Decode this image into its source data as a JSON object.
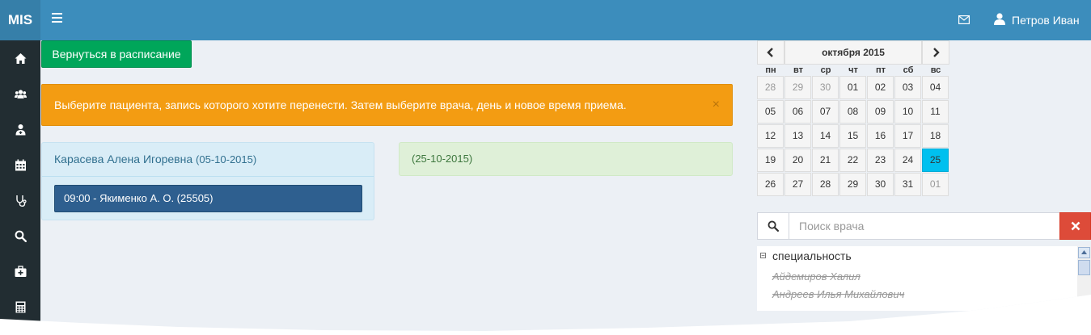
{
  "brand": "MIS",
  "header": {
    "user_name": "Петров Иван",
    "menu_icon": "hamburger-menu-icon",
    "mail_icon": "envelope-icon",
    "user_icon": "user-icon"
  },
  "sidebar": {
    "items": [
      {
        "icon": "home-icon"
      },
      {
        "icon": "users-icon"
      },
      {
        "icon": "doctor-icon"
      },
      {
        "icon": "calendar-icon"
      },
      {
        "icon": "stethoscope-icon"
      },
      {
        "icon": "search-icon"
      },
      {
        "icon": "medkit-icon"
      },
      {
        "icon": "calculator-icon"
      }
    ]
  },
  "actions": {
    "back_label": "Вернуться в расписание"
  },
  "alert": {
    "text": "Выберите пациента, запись которого хотите перенести. Затем выберите врача, день и новое время приема.",
    "close": "×"
  },
  "patient_panel": {
    "name": "Карасева Алена Игоревна",
    "date": "(05-10-2015)",
    "appointment": "09:00 - Якименко А. О. (25505)"
  },
  "new_panel": {
    "date": "(25-10-2015)"
  },
  "calendar": {
    "title": "октября 2015",
    "weekdays": [
      "пн",
      "вт",
      "ср",
      "чт",
      "пт",
      "сб",
      "вс"
    ],
    "weeks": [
      [
        "28",
        "29",
        "30",
        "01",
        "02",
        "03",
        "04"
      ],
      [
        "05",
        "06",
        "07",
        "08",
        "09",
        "10",
        "11"
      ],
      [
        "12",
        "13",
        "14",
        "15",
        "16",
        "17",
        "18"
      ],
      [
        "19",
        "20",
        "21",
        "22",
        "23",
        "24",
        "25"
      ],
      [
        "26",
        "27",
        "28",
        "29",
        "30",
        "31",
        "01"
      ]
    ],
    "selected": "25"
  },
  "doctor_search": {
    "placeholder": "Поиск врача"
  },
  "tree": {
    "toggle": "−",
    "group": "специальность",
    "doctors": [
      "Айдемиров Халил",
      "Андреев Илья Михайлович"
    ]
  },
  "colors": {
    "header": "#3c8dbc",
    "sidebar": "#222d32",
    "alert": "#f39c12",
    "success": "#00a65a",
    "selected_day": "#00c0ef",
    "danger": "#dd4b39"
  }
}
